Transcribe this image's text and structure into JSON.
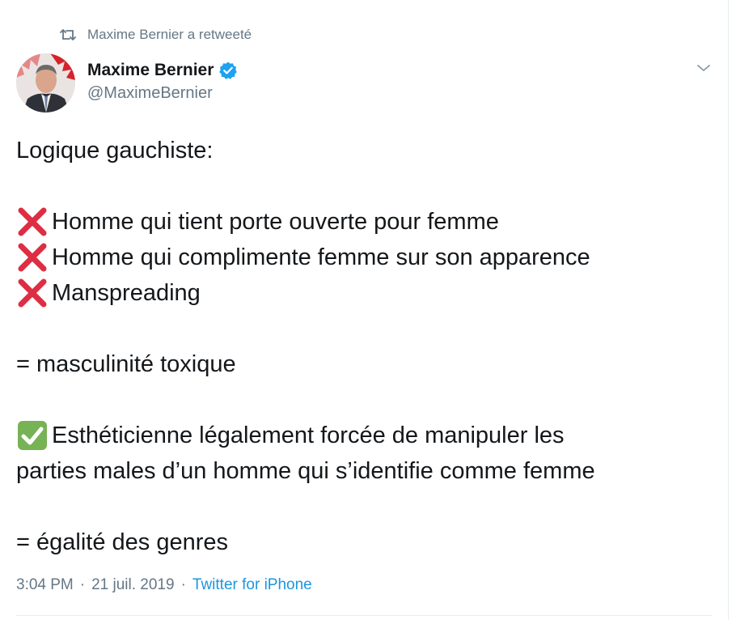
{
  "retweet_banner": {
    "text": "Maxime Bernier a retweeté"
  },
  "author": {
    "display_name": "Maxime Bernier",
    "handle": "@MaximeBernier",
    "verified": true
  },
  "tweet": {
    "lines": [
      {
        "mark": "",
        "text": "Logique gauchiste:"
      },
      {
        "mark": "",
        "text": ""
      },
      {
        "mark": "cross-mark-icon",
        "text": "Homme qui tient porte ouverte pour femme"
      },
      {
        "mark": "cross-mark-icon",
        "text": "Homme qui complimente femme sur son apparence"
      },
      {
        "mark": "cross-mark-icon",
        "text": "Manspreading"
      },
      {
        "mark": "",
        "text": ""
      },
      {
        "mark": "",
        "text": "= masculinité toxique"
      },
      {
        "mark": "",
        "text": ""
      },
      {
        "mark": "check-mark-icon",
        "text": "Esthéticienne légalement forcée de manipuler les"
      },
      {
        "mark": "",
        "text": "parties males d’un homme qui s’identifie comme femme"
      },
      {
        "mark": "",
        "text": ""
      },
      {
        "mark": "",
        "text": "= égalité des genres"
      }
    ]
  },
  "meta": {
    "time": "3:04 PM",
    "separator": "·",
    "date": "21 juil. 2019",
    "source": "Twitter for iPhone"
  },
  "colors": {
    "text": "#14171a",
    "secondary": "#657786",
    "accent": "#1b95e0",
    "verified": "#1da1f2",
    "cross": "#dd2e44",
    "check": "#77b255"
  }
}
